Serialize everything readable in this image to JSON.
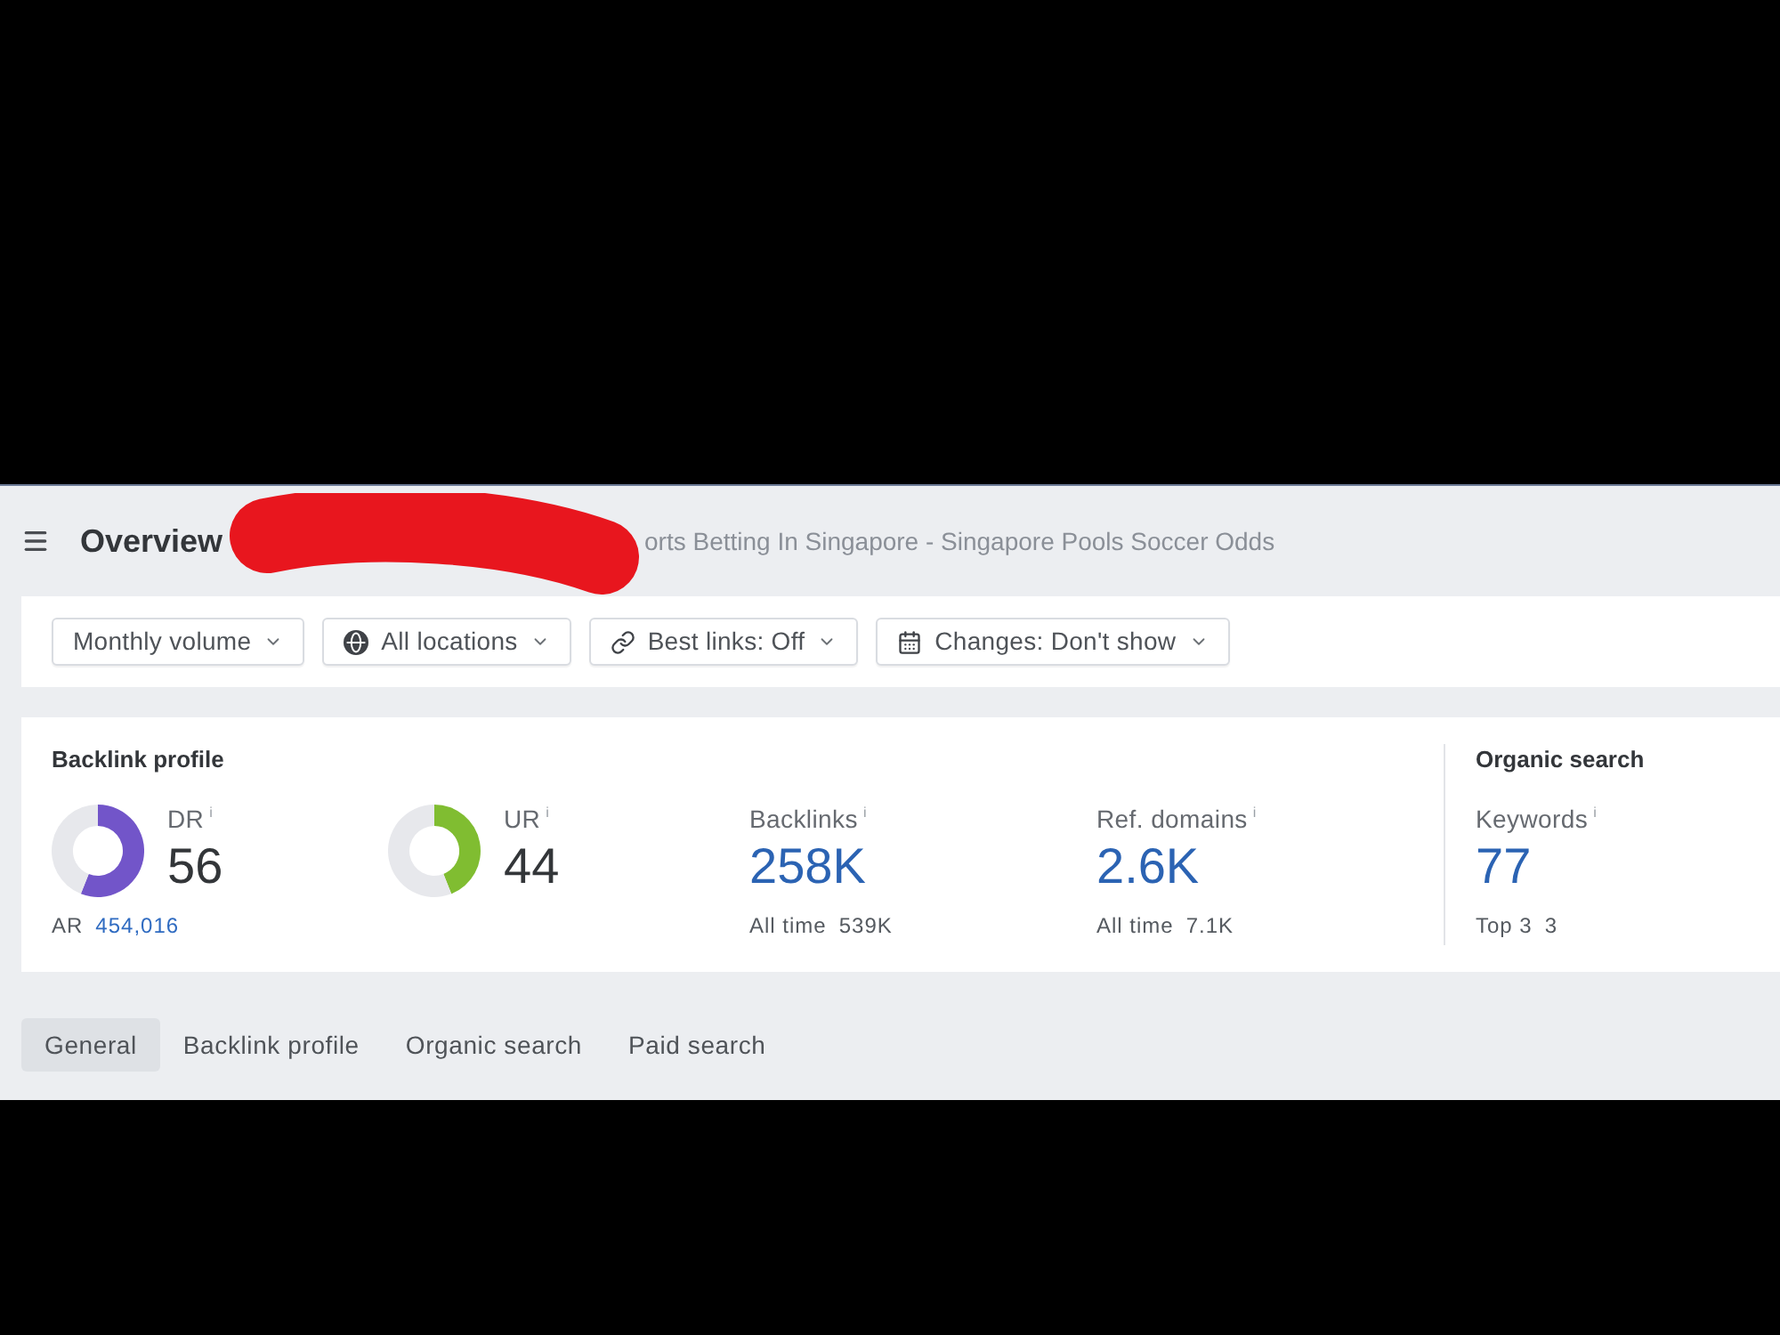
{
  "header": {
    "title": "Overview",
    "subtitle": "orts Betting In Singapore - Singapore Pools Soccer Odds"
  },
  "filters": [
    {
      "label": "Monthly volume"
    },
    {
      "label": "All locations"
    },
    {
      "label": "Best links: Off"
    },
    {
      "label": "Changes: Don't show"
    }
  ],
  "sections": [
    {
      "title": "Backlink profile",
      "metrics": [
        {
          "kind": "ring",
          "label": "DR",
          "info": "i",
          "value": "56",
          "chart_data": {
            "type": "donut",
            "values": [
              56,
              44
            ],
            "colors": [
              "#7255c9",
              "#e7e8ec"
            ]
          },
          "footer": {
            "label": "AR",
            "value": "454,016"
          }
        },
        {
          "kind": "ring",
          "label": "UR",
          "info": "i",
          "value": "44",
          "chart_data": {
            "type": "donut",
            "values": [
              44,
              56
            ],
            "colors": [
              "#80bd31",
              "#e7e8ec"
            ]
          }
        },
        {
          "kind": "count",
          "label": "Backlinks",
          "info": "i",
          "value": "258K",
          "footer": {
            "label": "All time",
            "value": "539K"
          }
        },
        {
          "kind": "count",
          "label": "Ref. domains",
          "info": "i",
          "value": "2.6K",
          "footer": {
            "label": "All time",
            "value": "7.1K"
          }
        }
      ]
    },
    {
      "title": "Organic search",
      "metrics": [
        {
          "kind": "count",
          "label": "Keywords",
          "info": "i",
          "value": "77",
          "footer": {
            "label": "Top 3",
            "value": "3"
          }
        }
      ]
    }
  ],
  "tabs": [
    {
      "label": "General",
      "selected": true
    },
    {
      "label": "Backlink profile",
      "selected": false
    },
    {
      "label": "Organic search",
      "selected": false
    },
    {
      "label": "Paid search",
      "selected": false
    }
  ]
}
